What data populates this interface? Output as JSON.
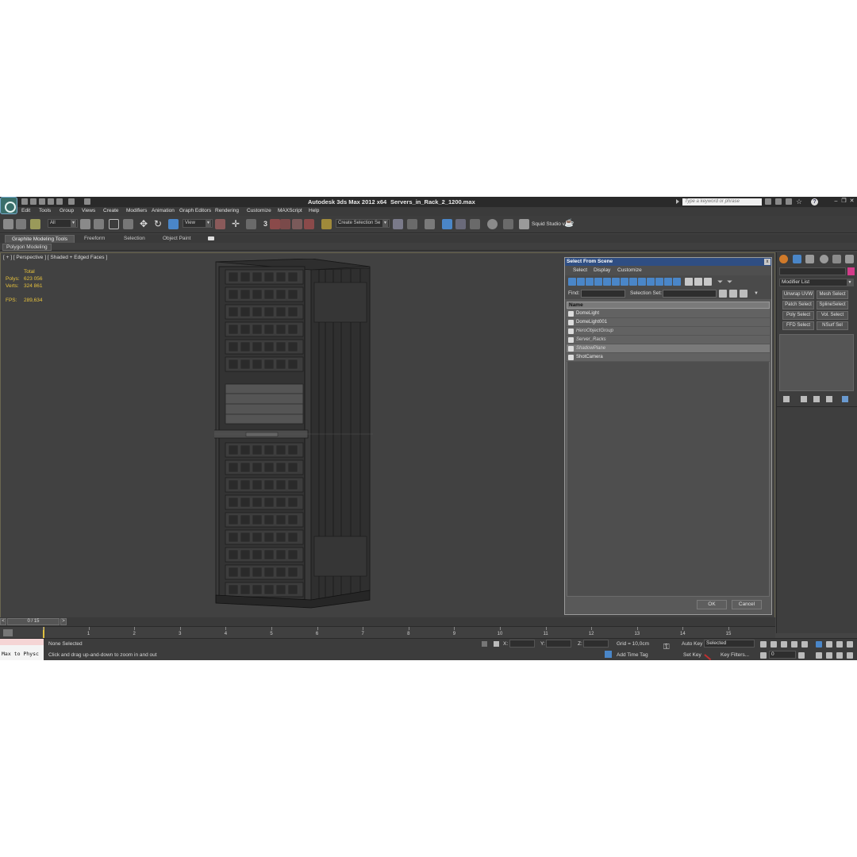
{
  "window": {
    "title": "Autodesk 3ds Max  2012 x64",
    "file_name": "Servers_in_Rack_2_1200.max",
    "search_placeholder": "Type a keyword or phrase"
  },
  "menu": [
    "Edit",
    "Tools",
    "Group",
    "Views",
    "Create",
    "Modifiers",
    "Animation",
    "Graph Editors",
    "Rendering",
    "Customize",
    "MAXScript",
    "Help"
  ],
  "toolbar": {
    "filter_value": "All",
    "ref_coord_value": "View",
    "snap_number": "3",
    "selection_set_placeholder": "Create Selection Se",
    "workspace_label": "Squid Studio v"
  },
  "ribbon": {
    "tabs": [
      "Graphite Modeling Tools",
      "Freeform",
      "Selection",
      "Object Paint"
    ],
    "active_tab": "Graphite Modeling Tools",
    "panel_label": "Polygon Modeling"
  },
  "viewport": {
    "label": "[ + ] [ Perspective ] [ Shaded + Edged Faces ]",
    "stats": {
      "total_label": "Total",
      "polys_label": "Polys:",
      "polys_value": "623 056",
      "verts_label": "Verts:",
      "verts_value": "324 861",
      "fps_label": "FPS:",
      "fps_value": "289,634"
    }
  },
  "scene_dialog": {
    "title": "Select From Scene",
    "close_glyph": "x",
    "menu": [
      "Select",
      "Display",
      "Customize"
    ],
    "find_label": "Find:",
    "find_value": "",
    "selection_set_label": "Selection Set:",
    "column_header": "Name",
    "items": [
      {
        "name": "DomeLight",
        "italic": false,
        "selected": false
      },
      {
        "name": "DomeLight001",
        "italic": false,
        "selected": false
      },
      {
        "name": "HeroObjectGroup",
        "italic": true,
        "selected": false
      },
      {
        "name": "Server_Racks",
        "italic": true,
        "selected": false
      },
      {
        "name": "ShadowPlane",
        "italic": true,
        "selected": true
      },
      {
        "name": "ShotCamera",
        "italic": false,
        "selected": false
      }
    ],
    "ok_label": "OK",
    "cancel_label": "Cancel"
  },
  "command_panel": {
    "modifier_list_label": "Modifier List",
    "modifier_buttons": [
      "Unwrap UVW",
      "Mesh Select",
      "Patch Select",
      "SplineSelect",
      "Poly Select",
      "Vol. Select",
      "FFD Select",
      "NSurf Sel"
    ],
    "name_field_value": "",
    "color_swatch": "#d43c8a"
  },
  "timeline": {
    "frame_display": "0 / 15",
    "prev_glyph": "<",
    "next_glyph": ">",
    "ticks": [
      "0",
      "1",
      "2",
      "3",
      "4",
      "5",
      "6",
      "7",
      "8",
      "9",
      "10",
      "11",
      "12",
      "13",
      "14",
      "15"
    ]
  },
  "status": {
    "maxscript_listener": "Max to Physc",
    "selection_status": "None Selected",
    "prompt": "Click and drag up-and-down to zoom in and out",
    "x_label": "X:",
    "y_label": "Y:",
    "z_label": "Z:",
    "grid": "Grid = 10,0cm",
    "add_time_tag": "Add Time Tag",
    "auto_key": "Auto Key",
    "set_key": "Set Key",
    "key_mode_value": "Selected",
    "key_filters": "Key Filters...",
    "current_frame": "0"
  },
  "colors": {
    "stats_yellow": "#e7c23c",
    "dialog_title_blue": "#2f4e83",
    "active_icon_blue": "#4a86c8",
    "auto_key_red": "#c03030"
  }
}
